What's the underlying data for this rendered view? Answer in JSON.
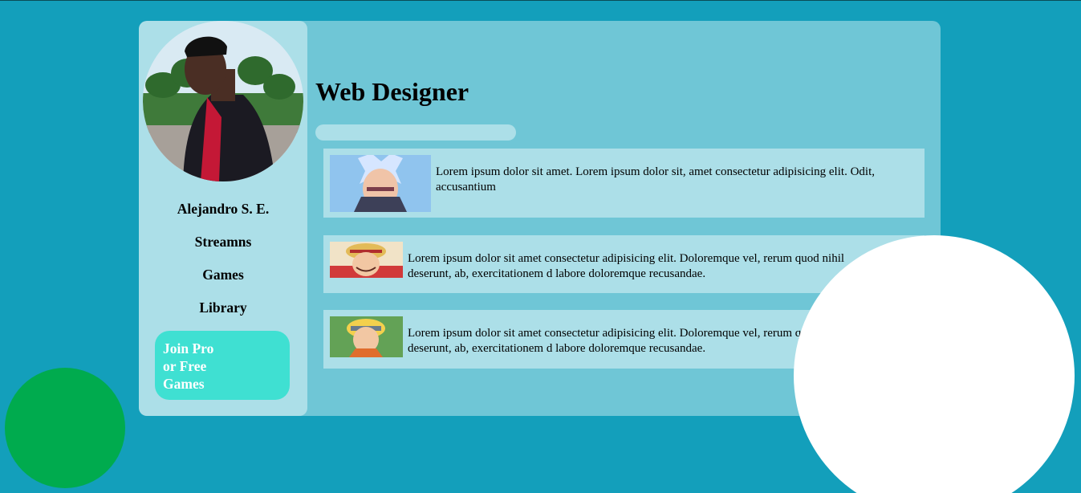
{
  "profile": {
    "name": "Alejandro S. E."
  },
  "sidebar": {
    "items": [
      {
        "label": "Streamns"
      },
      {
        "label": "Games"
      },
      {
        "label": "Library"
      }
    ],
    "cta_lines": [
      "Join Pro",
      "or Free",
      "Games"
    ]
  },
  "main": {
    "title": "Web Designer",
    "cards": [
      {
        "text": "Lorem ipsum dolor sit amet. Lorem ipsum dolor sit, amet consectetur adipisicing elit. Odit, accusantium"
      },
      {
        "text": "Lorem ipsum dolor sit amet consectetur adipisicing elit. Doloremque vel, rerum quod nihil deserunt, ab, exercitationem d labore doloremque recusandae."
      },
      {
        "text": "Lorem ipsum dolor sit amet consectetur adipisicing elit. Doloremque vel, rerum quod nihil deserunt, ab, exercitationem d labore doloremque recusandae."
      }
    ]
  },
  "colors": {
    "background": "#139fbb",
    "panel": "#6fc6d6",
    "sidebar": "#acdfe8",
    "cta": "#3fe0d2",
    "green_circle": "#00ab4e",
    "white_circle": "#ffffff"
  }
}
